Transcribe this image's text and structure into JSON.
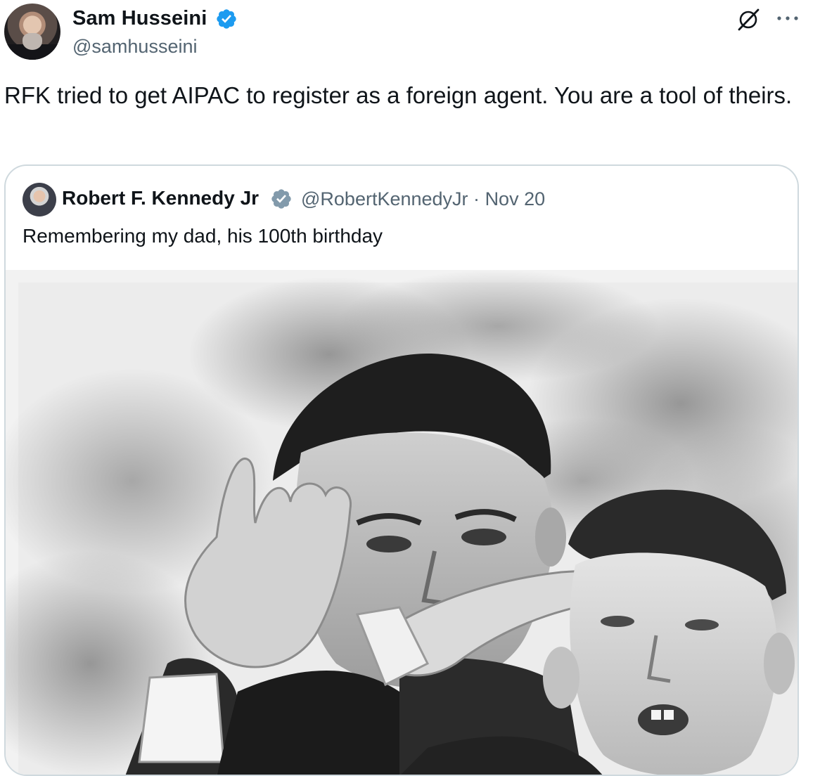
{
  "author": {
    "display_name": "Sam Husseini",
    "handle": "@samhusseini"
  },
  "tweet": {
    "text": "RFK tried to get AIPAC to register as a foreign agent. You are a tool of theirs."
  },
  "quoted_tweet": {
    "display_name": "Robert F. Kennedy Jr",
    "handle": "@RobertKennedyJr",
    "separator": "·",
    "date": "Nov 20",
    "text": "Remembering my dad, his 100th birthday"
  },
  "icons": {
    "verified": "verified-badge-icon",
    "grok": "grok-icon",
    "more": "more-options-icon"
  },
  "colors": {
    "verified_blue": "#1d9bf0",
    "quote_verified_gray": "#829aab",
    "secondary_text": "#536471",
    "border": "#cfd9de"
  }
}
